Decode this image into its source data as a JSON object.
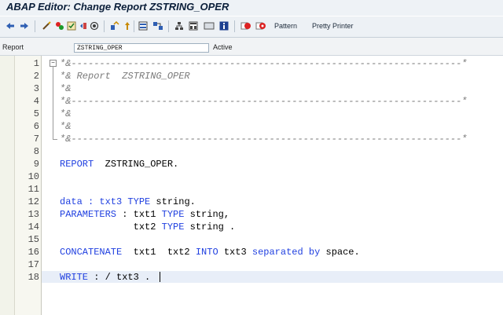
{
  "window": {
    "title": "ABAP Editor: Change Report ZSTRING_OPER"
  },
  "toolbar": {
    "pattern_label": "Pattern",
    "pretty_printer_label": "Pretty Printer"
  },
  "report_bar": {
    "label": "Report",
    "value": "ZSTRING_OPER",
    "status": "Active"
  },
  "editor": {
    "line_numbers": [
      "1",
      "2",
      "3",
      "4",
      "5",
      "6",
      "7",
      "8",
      "9",
      "10",
      "11",
      "12",
      "13",
      "14",
      "15",
      "16",
      "17",
      "18"
    ],
    "lines": {
      "l1": "*&---------------------------------------------------------------------*",
      "l2": "*& Report  ZSTRING_OPER",
      "l3": "*&",
      "l4": "*&---------------------------------------------------------------------*",
      "l5": "*&",
      "l6": "*&",
      "l7": "*&---------------------------------------------------------------------*",
      "l9_kw": "REPORT",
      "l9_rest": "  ZSTRING_OPER.",
      "l12_a": "data : txt3 ",
      "l12_kw": "TYPE",
      "l12_b": " string.",
      "l13_kw": "PARAMETERS",
      "l13_a": " : txt1 ",
      "l13_kw2": "TYPE",
      "l13_b": " string,",
      "l14_a": "             txt2 ",
      "l14_kw": "TYPE",
      "l14_b": " string .",
      "l16_kw": "CONCATENATE",
      "l16_a": "  txt1  txt2 ",
      "l16_kw2": "INTO",
      "l16_b": " txt3 ",
      "l16_kw3": "separated by",
      "l16_c": " space.",
      "l18_kw": "WRITE",
      "l18_a": " : / txt3 ."
    }
  },
  "colors": {
    "keyword": "#1f3fe0",
    "comment": "#7a7a7a",
    "current_line": "#e8eef8"
  }
}
